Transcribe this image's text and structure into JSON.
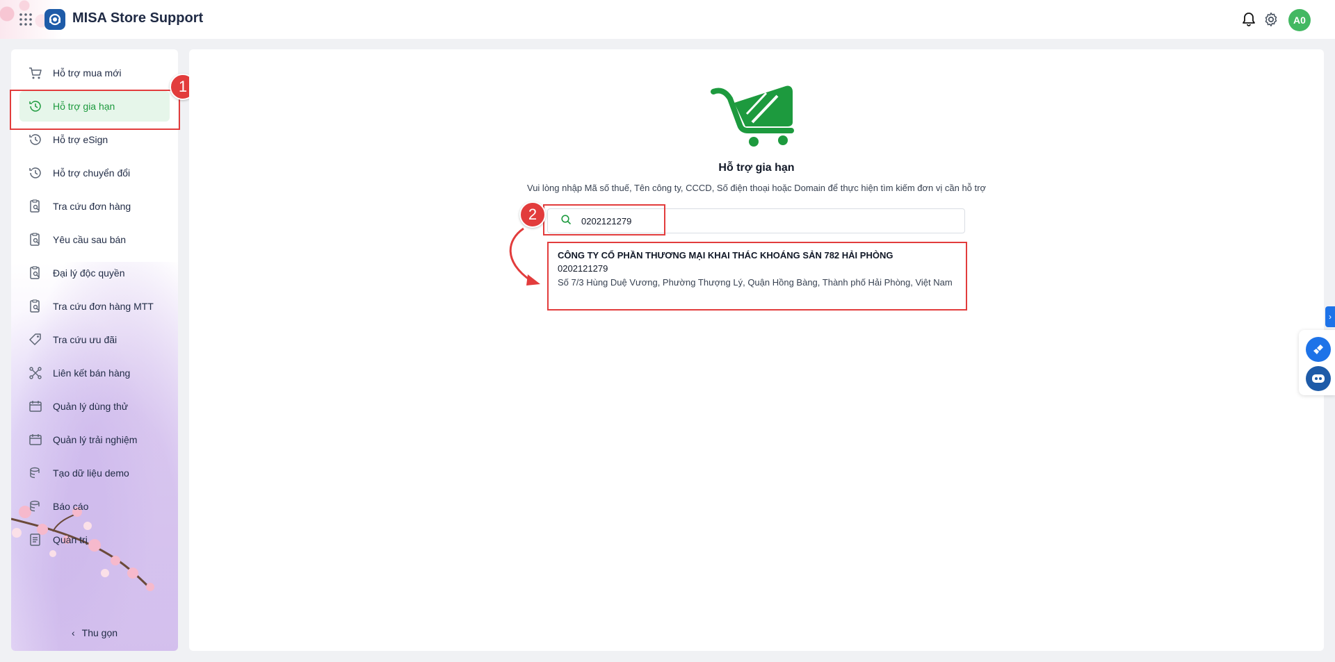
{
  "header": {
    "title": "MISA Store Support",
    "avatar_initials": "A0"
  },
  "sidebar": {
    "items": [
      {
        "label": "Hỗ trợ mua mới",
        "icon": "cart-icon"
      },
      {
        "label": "Hỗ trợ gia hạn",
        "icon": "history-icon",
        "active": true
      },
      {
        "label": "Hỗ trợ eSign",
        "icon": "history-icon"
      },
      {
        "label": "Hỗ trợ chuyển đổi",
        "icon": "history-icon"
      },
      {
        "label": "Tra cứu đơn hàng",
        "icon": "clipboard-search-icon"
      },
      {
        "label": "Yêu cầu sau bán",
        "icon": "clipboard-search-icon"
      },
      {
        "label": "Đại lý độc quyền",
        "icon": "clipboard-search-icon"
      },
      {
        "label": "Tra cứu đơn hàng MTT",
        "icon": "clipboard-search-icon"
      },
      {
        "label": "Tra cứu ưu đãi",
        "icon": "tag-icon"
      },
      {
        "label": "Liên kết bán hàng",
        "icon": "link-nodes-icon"
      },
      {
        "label": "Quản lý dùng thử",
        "icon": "calendar-icon"
      },
      {
        "label": "Quản lý trải nghiệm",
        "icon": "calendar-icon"
      },
      {
        "label": "Tạo dữ liệu demo",
        "icon": "database-icon"
      },
      {
        "label": "Báo cáo",
        "icon": "database-icon"
      },
      {
        "label": "Quản trị",
        "icon": "document-icon"
      }
    ],
    "collapse_label": "Thu gọn"
  },
  "main": {
    "title": "Hỗ trợ gia hạn",
    "subtitle": "Vui lòng nhập Mã số thuế, Tên công ty, CCCD, Số điện thoại hoặc Domain để thực hiện tìm kiếm đơn vị cần hỗ trợ",
    "search_value": "0202121279",
    "result": {
      "name": "CÔNG TY CỔ PHẦN THƯƠNG MẠI KHAI THÁC KHOÁNG SẢN 782 HẢI PHÒNG",
      "code": "0202121279",
      "address": "Số 7/3 Hùng Duệ Vương, Phường Thượng Lý, Quận Hồng Bàng, Thành phố Hải Phòng, Việt Nam"
    }
  },
  "annotations": {
    "step1": "1",
    "step2": "2"
  },
  "colors": {
    "accent_green": "#1d9a3e",
    "annotation_red": "#e23c3c",
    "brand_blue": "#1e5ba8"
  }
}
